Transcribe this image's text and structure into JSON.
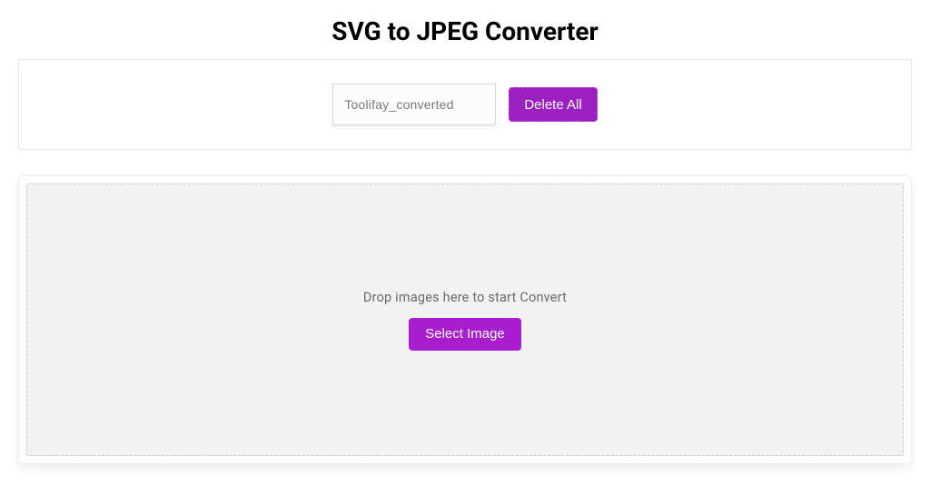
{
  "header": {
    "title": "SVG to JPEG Converter"
  },
  "toolbar": {
    "filename_value": "Toolifay_converted",
    "delete_label": "Delete All"
  },
  "dropzone": {
    "hint": "Drop images here to start Convert",
    "select_label": "Select Image"
  },
  "colors": {
    "accent": "#a81ecf"
  }
}
